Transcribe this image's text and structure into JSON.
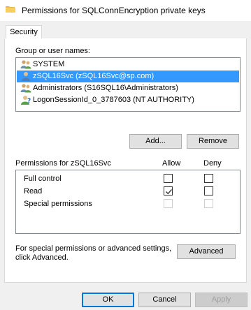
{
  "window": {
    "title": "Permissions for SQLConnEncryption private keys",
    "icon": "folder-icon"
  },
  "tabs": [
    {
      "label": "Security",
      "active": true
    }
  ],
  "group_section": {
    "label": "Group or user names:",
    "users": [
      {
        "name": "SYSTEM",
        "icon": "users-icon",
        "selected": false
      },
      {
        "name": "zSQL16Svc (zSQL16Svc@sp.com)",
        "icon": "user-icon",
        "selected": true
      },
      {
        "name": "Administrators (S16SQL16\\Administrators)",
        "icon": "users-icon",
        "selected": false
      },
      {
        "name": "LogonSessionId_0_3787603 (NT AUTHORITY)",
        "icon": "unknown-user-icon",
        "selected": false
      }
    ],
    "add_button": "Add...",
    "remove_button": "Remove"
  },
  "permissions_section": {
    "label": "Permissions for zSQL16Svc",
    "allow_header": "Allow",
    "deny_header": "Deny",
    "rows": [
      {
        "name": "Full control",
        "allow": false,
        "deny": false,
        "enabled": true
      },
      {
        "name": "Read",
        "allow": true,
        "deny": false,
        "enabled": true
      },
      {
        "name": "Special permissions",
        "allow": false,
        "deny": false,
        "enabled": false
      }
    ]
  },
  "advanced_section": {
    "text_line1": "For special permissions or advanced settings,",
    "text_line2": "click Advanced.",
    "button": "Advanced"
  },
  "footer": {
    "ok": "OK",
    "cancel": "Cancel",
    "apply": "Apply"
  },
  "colors": {
    "selection": "#3399ff",
    "dialog_bg": "#f0f0f0",
    "default_button_border": "#0078d7"
  }
}
